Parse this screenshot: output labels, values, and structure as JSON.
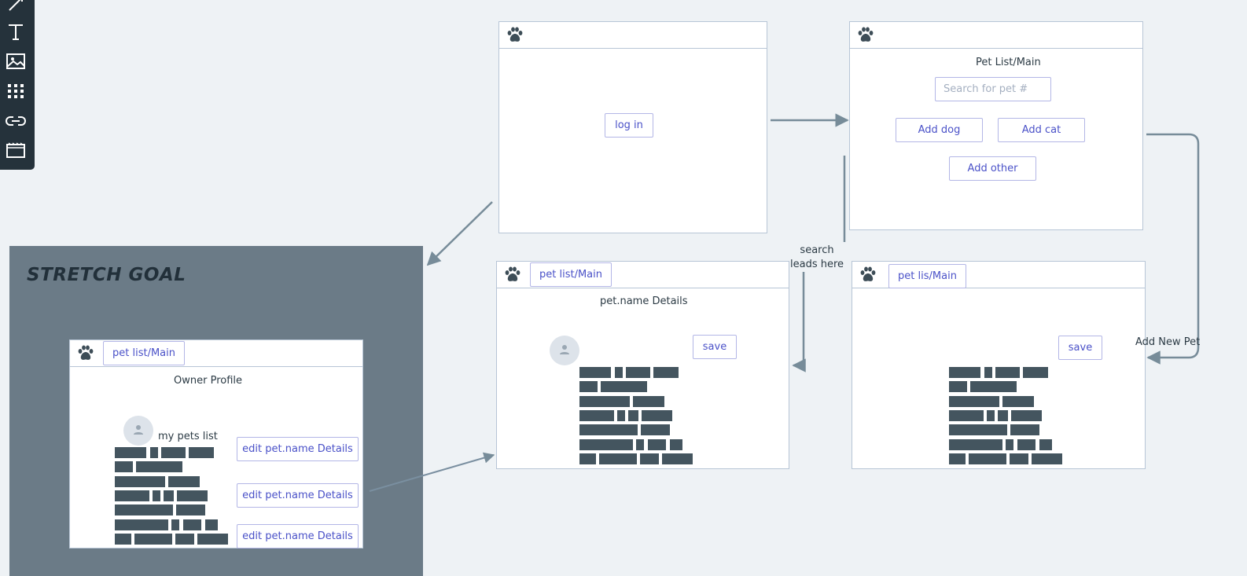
{
  "toolbar": {
    "tools": [
      {
        "icon": "pen-icon"
      },
      {
        "icon": "text-icon"
      },
      {
        "icon": "image-icon"
      },
      {
        "icon": "grid-icon"
      },
      {
        "icon": "link-icon"
      },
      {
        "icon": "frame-icon"
      }
    ]
  },
  "colors": {
    "canvas": "#eef2f5",
    "toolbar": "#25323b",
    "stretch_region": "#6b7b87",
    "frame_border": "#b7c5d6",
    "button_text": "#4a51c8",
    "arrow": "#778c99",
    "text_block": "#44555f"
  },
  "stretch_goal": {
    "title": "STRETCH GOAL"
  },
  "login_screen": {
    "login_button": "log in"
  },
  "pet_list_screen": {
    "title": "Pet List/Main",
    "search_placeholder": "Search for pet #",
    "add_dog": "Add dog",
    "add_cat": "Add cat",
    "add_other": "Add other"
  },
  "pet_details_screen": {
    "nav_button": "pet list/Main",
    "title": "pet.name Details",
    "save_button": "save"
  },
  "new_pet_screen": {
    "nav_button": "pet lis/Main",
    "save_button": "save"
  },
  "owner_profile_screen": {
    "nav_button": "pet list/Main",
    "title": "Owner Profile",
    "pets_list_label": "my pets list",
    "edit_buttons": [
      "edit pet.name Details",
      "edit pet.name Details",
      "edit pet.name Details"
    ]
  },
  "annotations": {
    "search_leads_here": [
      "search",
      "leads here"
    ],
    "add_new_pet": "Add New Pet"
  }
}
